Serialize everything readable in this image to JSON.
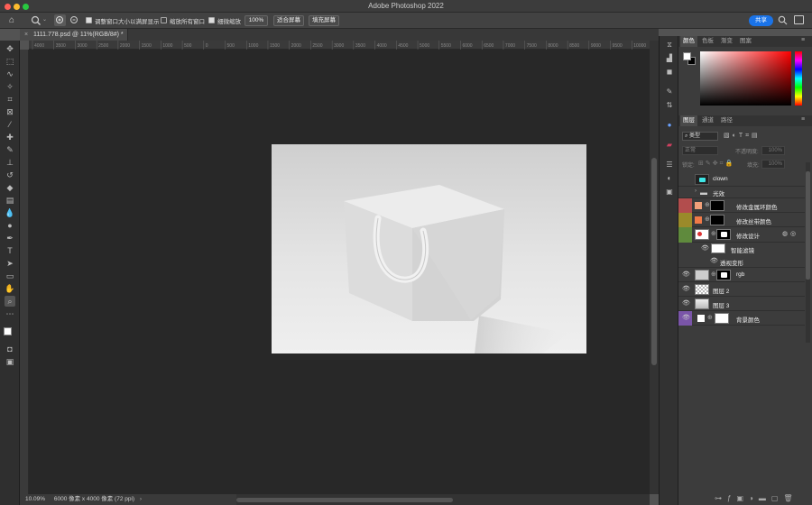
{
  "app": {
    "window_title": "Adobe Photoshop 2022"
  },
  "options_bar": {
    "checkbox_resize": "调整窗口大小以满屏显示",
    "checkbox_zoom_all": "缩放所有窗口",
    "checkbox_scrubby": "细微缩放",
    "zoom_100": "100%",
    "fit_screen": "适合屏幕",
    "fill_screen": "填充屏幕",
    "share": "共享"
  },
  "document_tab": {
    "label": "1111.778.psd @ 11%(RGB/8#) *"
  },
  "ruler": {
    "ticks": [
      "4000",
      "3500",
      "3000",
      "2500",
      "2000",
      "1500",
      "1000",
      "500",
      "0",
      "500",
      "1000",
      "1500",
      "2000",
      "2500",
      "3000",
      "3500",
      "4000",
      "4500",
      "5000",
      "5500",
      "6000",
      "6500",
      "7000",
      "7500",
      "8000",
      "8500",
      "9000",
      "9500",
      "10000"
    ]
  },
  "status": {
    "zoom": "10.09%",
    "info": "6000 像素 x 4000 像素 (72 ppi)"
  },
  "color_panel": {
    "tabs": [
      "颜色",
      "色板",
      "渐变",
      "图案"
    ]
  },
  "layers_panel": {
    "tabs": [
      "图层",
      "通道",
      "路径"
    ],
    "filter_kind": "类型",
    "blend_mode": "正常",
    "opacity_label": "不透明度:",
    "opacity_value": "100%",
    "lock_label": "锁定:",
    "fill_label": "填充:",
    "fill_value": "100%",
    "layers": [
      {
        "name": "clown",
        "color": "#3c3c3c",
        "visible": false
      },
      {
        "name": "光效",
        "color": "#3c3c3c",
        "visible": false
      },
      {
        "name": "修改金属环颜色",
        "color": "#b24d4d",
        "visible": false
      },
      {
        "name": "修改丝带颜色",
        "color": "#9a8a2a",
        "visible": false
      },
      {
        "name": "修改设计",
        "color": "#5f8a3d",
        "visible": true
      },
      {
        "name": "智能滤镜",
        "color": "#5f8a3d",
        "visible": true
      },
      {
        "name": "透视变形",
        "color": "#5f8a3d",
        "visible": true
      },
      {
        "name": "rgb",
        "color": "#3c3c3c",
        "visible": true
      },
      {
        "name": "图层 2",
        "color": "#3c3c3c",
        "visible": true
      },
      {
        "name": "图层 3",
        "color": "#3c3c3c",
        "visible": true
      },
      {
        "name": "背景颜色",
        "color": "#7a55a8",
        "visible": true
      }
    ]
  },
  "colors": {
    "accent": "#1a73e8",
    "fg": "#ffffff",
    "bg": "#000000"
  }
}
